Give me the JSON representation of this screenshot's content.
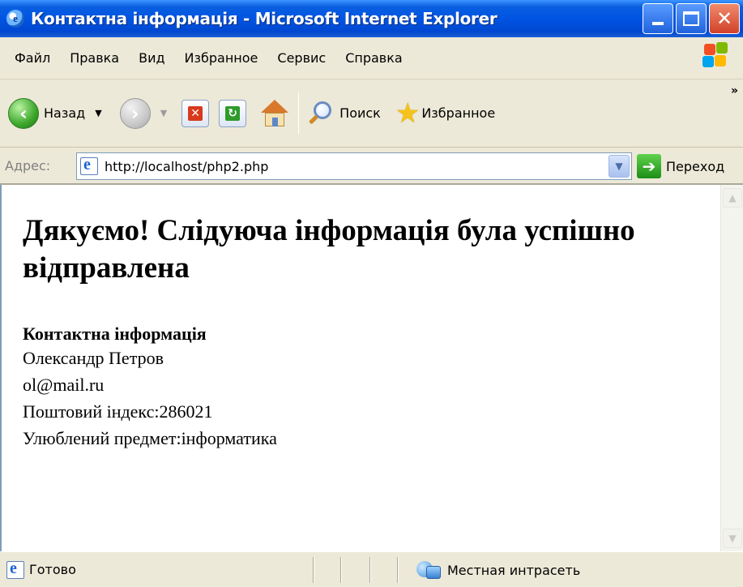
{
  "window": {
    "title": "Контактна інформація - Microsoft Internet Explorer"
  },
  "menubar": {
    "items": [
      "Файл",
      "Правка",
      "Вид",
      "Избранное",
      "Сервис",
      "Справка"
    ]
  },
  "toolbar": {
    "back_label": "Назад",
    "search_label": "Поиск",
    "favorites_label": "Избранное",
    "more_chevron": "»"
  },
  "address": {
    "label": "Адрес:",
    "url": "http://localhost/php2.php",
    "go_label": "Переход"
  },
  "page": {
    "heading": "Дякуємо! Слідуюча інформація була успішно відправлена",
    "section_title": "Контактна інформація",
    "name": "Олександр Петров",
    "email": "ol@mail.ru",
    "postal": "Поштовий індекс:286021",
    "subject": "Улюблений предмет:інформатика"
  },
  "status": {
    "text": "Готово",
    "zone": "Местная интрасеть"
  },
  "colors": {
    "titlebar": "#0054e3",
    "chrome": "#ece9d8",
    "close_button": "#d2412a"
  }
}
